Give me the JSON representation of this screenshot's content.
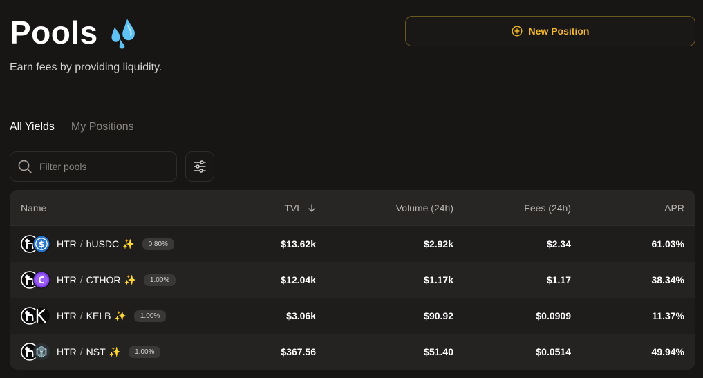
{
  "header": {
    "title": "Pools",
    "subtitle": "Earn fees by providing liquidity.",
    "new_position_label": "New Position"
  },
  "tabs": [
    {
      "label": "All Yields",
      "active": true
    },
    {
      "label": "My Positions",
      "active": false
    }
  ],
  "search": {
    "placeholder": "Filter pools",
    "value": ""
  },
  "table": {
    "headers": {
      "name": "Name",
      "tvl": "TVL",
      "volume": "Volume (24h)",
      "fees": "Fees (24h)",
      "apr": "APR"
    },
    "rows": [
      {
        "token_a": "HTR",
        "token_b": "hUSDC",
        "fee_tier": "0.80%",
        "tvl": "$13.62k",
        "volume": "$2.92k",
        "fees": "$2.34",
        "apr": "61.03%"
      },
      {
        "token_a": "HTR",
        "token_b": "CTHOR",
        "fee_tier": "1.00%",
        "tvl": "$12.04k",
        "volume": "$1.17k",
        "fees": "$1.17",
        "apr": "38.34%"
      },
      {
        "token_a": "HTR",
        "token_b": "KELB",
        "fee_tier": "1.00%",
        "tvl": "$3.06k",
        "volume": "$90.92",
        "fees": "$0.0909",
        "apr": "11.37%"
      },
      {
        "token_a": "HTR",
        "token_b": "NST",
        "fee_tier": "1.00%",
        "tvl": "$367.56",
        "volume": "$51.40",
        "fees": "$0.0514",
        "apr": "49.94%"
      }
    ]
  },
  "colors": {
    "background": "#171615",
    "accent": "#f4b82c",
    "table_bg": "#242221"
  },
  "icons": {
    "title": "sweat-droplets-icon",
    "new_position": "plus-circle-icon",
    "search": "search-icon",
    "filter": "sliders-icon",
    "sort": "arrow-down-icon",
    "sparkle": "sparkles-icon"
  }
}
